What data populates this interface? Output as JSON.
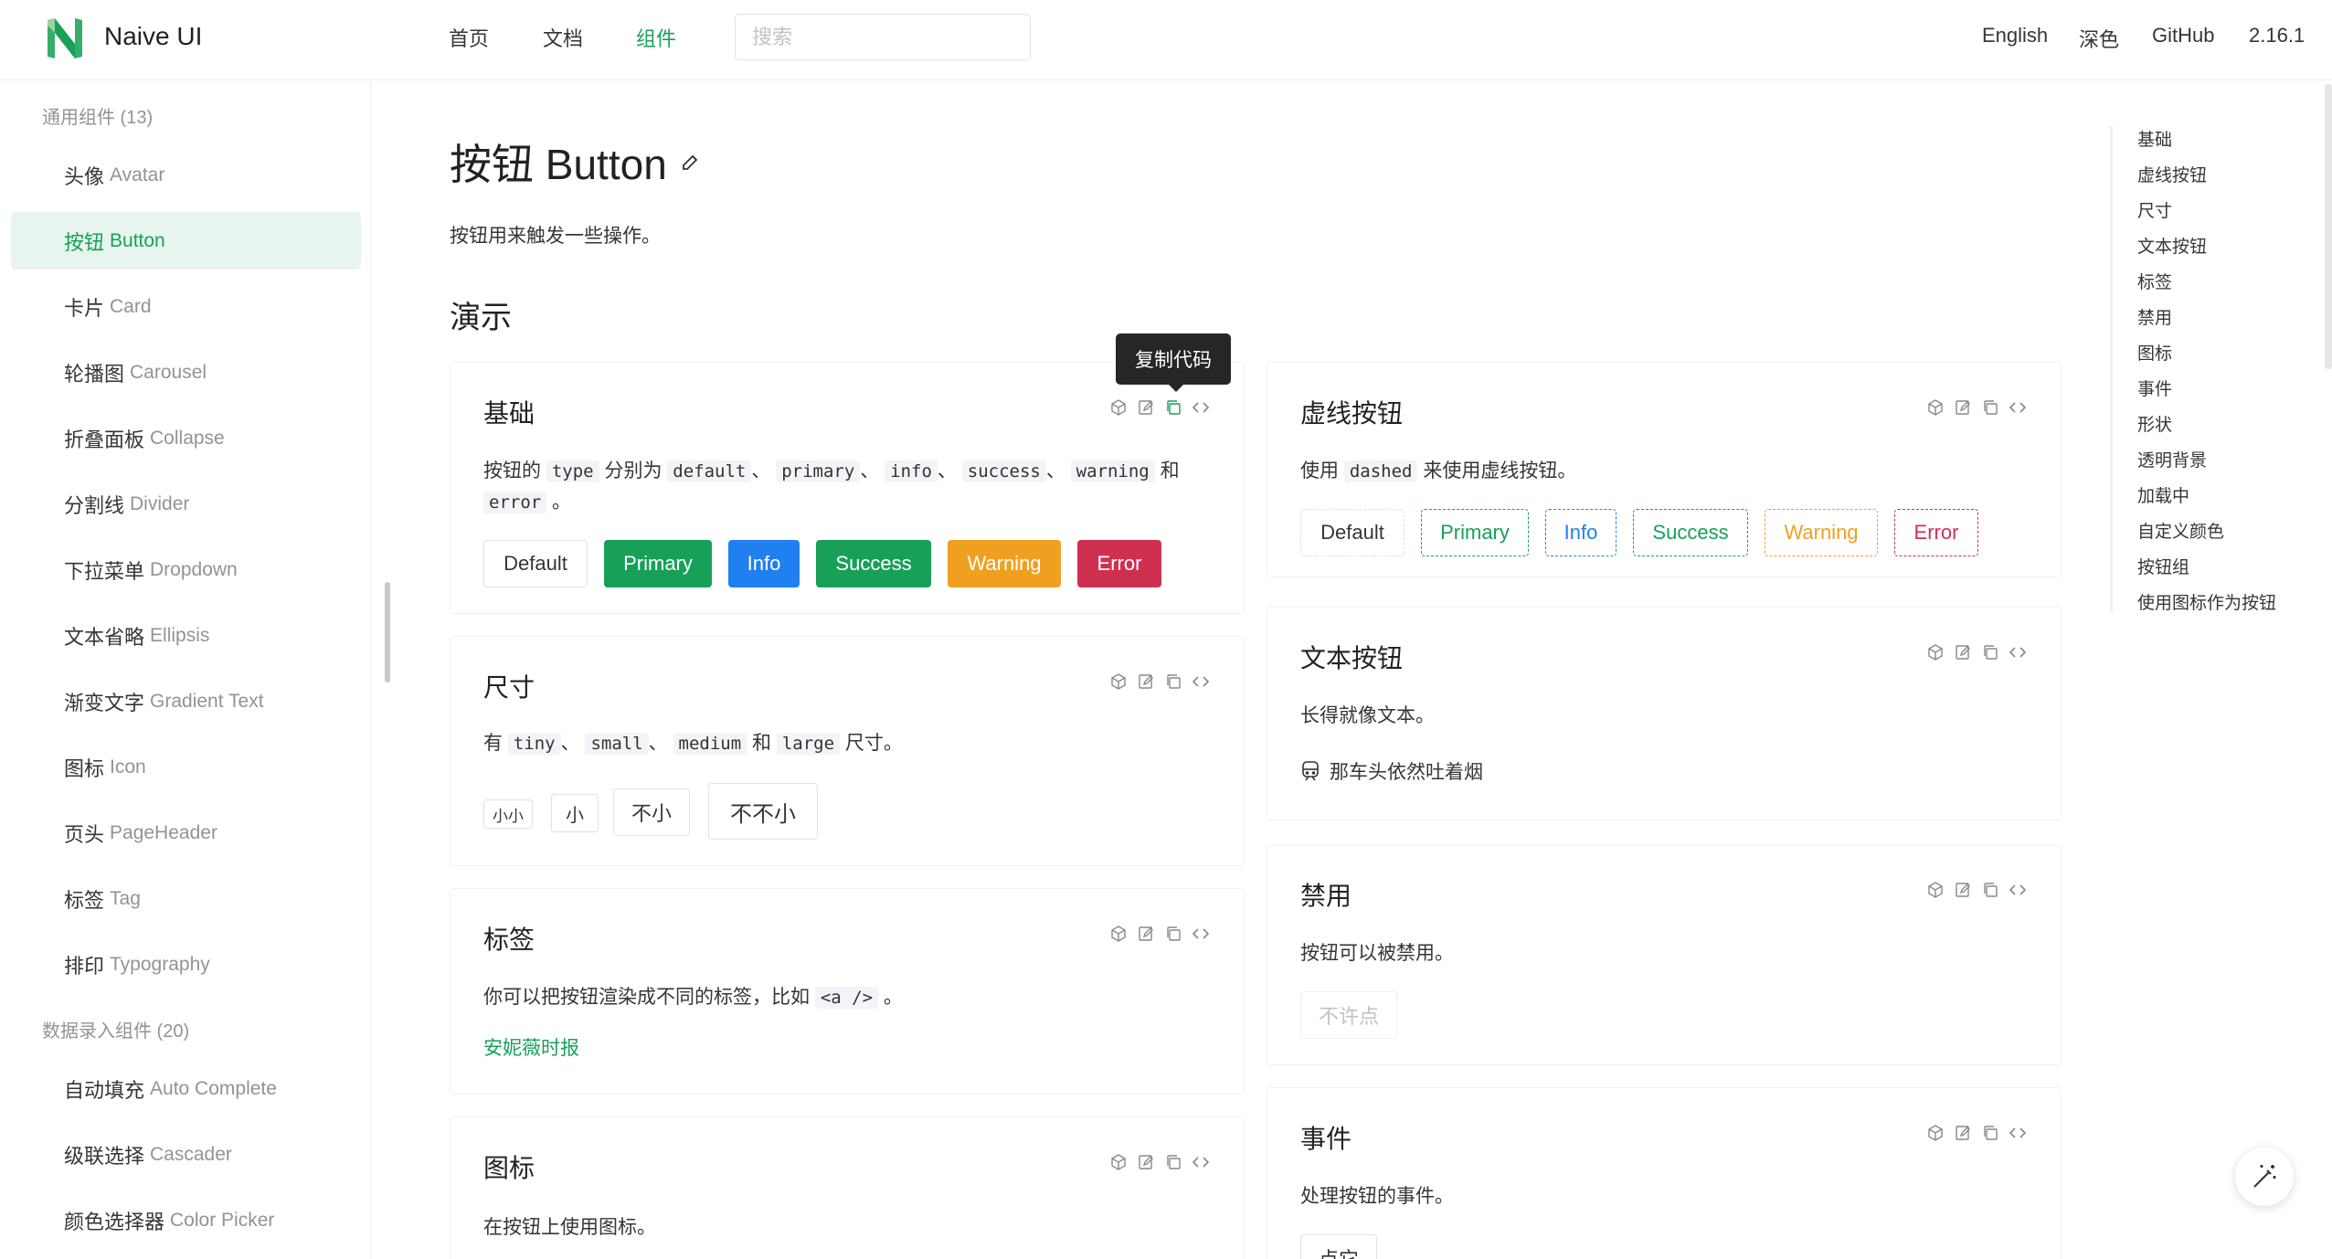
{
  "header": {
    "brand": "Naive UI",
    "nav": [
      "首页",
      "文档",
      "组件"
    ],
    "search_placeholder": "搜索",
    "right": [
      "English",
      "深色",
      "GitHub",
      "2.16.1"
    ]
  },
  "sidebar": {
    "group1": "通用组件 (13)",
    "items1": [
      {
        "zh": "头像",
        "en": "Avatar"
      },
      {
        "zh": "按钮",
        "en": "Button"
      },
      {
        "zh": "卡片",
        "en": "Card"
      },
      {
        "zh": "轮播图",
        "en": "Carousel"
      },
      {
        "zh": "折叠面板",
        "en": "Collapse"
      },
      {
        "zh": "分割线",
        "en": "Divider"
      },
      {
        "zh": "下拉菜单",
        "en": "Dropdown"
      },
      {
        "zh": "文本省略",
        "en": "Ellipsis"
      },
      {
        "zh": "渐变文字",
        "en": "Gradient Text"
      },
      {
        "zh": "图标",
        "en": "Icon"
      },
      {
        "zh": "页头",
        "en": "PageHeader"
      },
      {
        "zh": "标签",
        "en": "Tag"
      },
      {
        "zh": "排印",
        "en": "Typography"
      }
    ],
    "group2": "数据录入组件 (20)",
    "items2": [
      {
        "zh": "自动填充",
        "en": "Auto Complete"
      },
      {
        "zh": "级联选择",
        "en": "Cascader"
      },
      {
        "zh": "颜色选择器",
        "en": "Color Picker"
      }
    ]
  },
  "main": {
    "title": "按钮 Button",
    "desc": "按钮用来触发一些操作。",
    "demo_heading": "演示",
    "tooltip": "复制代码"
  },
  "cards": {
    "basic": {
      "title": "基础",
      "d1": "按钮的",
      "c1": "type",
      "d2": "分别为",
      "c2": "default",
      "c3": "primary",
      "c4": "info",
      "c5": "success",
      "c6": "warning",
      "d3": "和",
      "c7": "error",
      "d4": "。",
      "sep": "、",
      "buttons": [
        "Default",
        "Primary",
        "Info",
        "Success",
        "Warning",
        "Error"
      ]
    },
    "size": {
      "title": "尺寸",
      "d1": "有",
      "c1": "tiny",
      "c2": "small",
      "c3": "medium",
      "d2": "和",
      "c4": "large",
      "d3": "尺寸。",
      "buttons": [
        "小小",
        "小",
        "不小",
        "不不小"
      ]
    },
    "tag": {
      "title": "标签",
      "desc": "你可以把按钮渲染成不同的标签，比如",
      "code": "<a />",
      "end": "。",
      "link": "安妮薇时报"
    },
    "icon": {
      "title": "图标",
      "desc": "在按钮上使用图标。"
    },
    "dashed": {
      "title": "虚线按钮",
      "d1": "使用",
      "c1": "dashed",
      "d2": "来使用虚线按钮。",
      "buttons": [
        "Default",
        "Primary",
        "Info",
        "Success",
        "Warning",
        "Error"
      ]
    },
    "text": {
      "title": "文本按钮",
      "desc": "长得就像文本。",
      "button": "那车头依然吐着烟"
    },
    "disabled": {
      "title": "禁用",
      "desc": "按钮可以被禁用。",
      "button": "不许点"
    },
    "event": {
      "title": "事件",
      "desc": "处理按钮的事件。",
      "button": "点它"
    }
  },
  "toc": [
    "基础",
    "虚线按钮",
    "尺寸",
    "文本按钮",
    "标签",
    "禁用",
    "图标",
    "事件",
    "形状",
    "透明背景",
    "加载中",
    "自定义颜色",
    "按钮组",
    "使用图标作为按钮"
  ],
  "colors": {
    "primary": "#18a058",
    "info": "#2080f0",
    "warning": "#f0a020",
    "error": "#d03050"
  }
}
